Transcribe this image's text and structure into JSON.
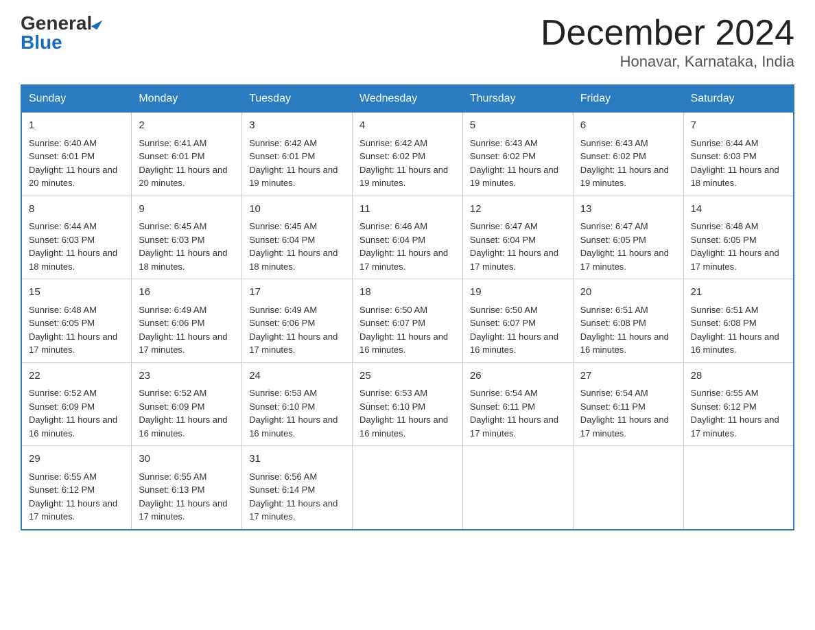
{
  "header": {
    "logo_general": "General",
    "logo_blue": "Blue",
    "month_title": "December 2024",
    "location": "Honavar, Karnataka, India"
  },
  "weekdays": [
    "Sunday",
    "Monday",
    "Tuesday",
    "Wednesday",
    "Thursday",
    "Friday",
    "Saturday"
  ],
  "weeks": [
    [
      {
        "day": "1",
        "sunrise": "6:40 AM",
        "sunset": "6:01 PM",
        "daylight": "11 hours and 20 minutes."
      },
      {
        "day": "2",
        "sunrise": "6:41 AM",
        "sunset": "6:01 PM",
        "daylight": "11 hours and 20 minutes."
      },
      {
        "day": "3",
        "sunrise": "6:42 AM",
        "sunset": "6:01 PM",
        "daylight": "11 hours and 19 minutes."
      },
      {
        "day": "4",
        "sunrise": "6:42 AM",
        "sunset": "6:02 PM",
        "daylight": "11 hours and 19 minutes."
      },
      {
        "day": "5",
        "sunrise": "6:43 AM",
        "sunset": "6:02 PM",
        "daylight": "11 hours and 19 minutes."
      },
      {
        "day": "6",
        "sunrise": "6:43 AM",
        "sunset": "6:02 PM",
        "daylight": "11 hours and 19 minutes."
      },
      {
        "day": "7",
        "sunrise": "6:44 AM",
        "sunset": "6:03 PM",
        "daylight": "11 hours and 18 minutes."
      }
    ],
    [
      {
        "day": "8",
        "sunrise": "6:44 AM",
        "sunset": "6:03 PM",
        "daylight": "11 hours and 18 minutes."
      },
      {
        "day": "9",
        "sunrise": "6:45 AM",
        "sunset": "6:03 PM",
        "daylight": "11 hours and 18 minutes."
      },
      {
        "day": "10",
        "sunrise": "6:45 AM",
        "sunset": "6:04 PM",
        "daylight": "11 hours and 18 minutes."
      },
      {
        "day": "11",
        "sunrise": "6:46 AM",
        "sunset": "6:04 PM",
        "daylight": "11 hours and 17 minutes."
      },
      {
        "day": "12",
        "sunrise": "6:47 AM",
        "sunset": "6:04 PM",
        "daylight": "11 hours and 17 minutes."
      },
      {
        "day": "13",
        "sunrise": "6:47 AM",
        "sunset": "6:05 PM",
        "daylight": "11 hours and 17 minutes."
      },
      {
        "day": "14",
        "sunrise": "6:48 AM",
        "sunset": "6:05 PM",
        "daylight": "11 hours and 17 minutes."
      }
    ],
    [
      {
        "day": "15",
        "sunrise": "6:48 AM",
        "sunset": "6:05 PM",
        "daylight": "11 hours and 17 minutes."
      },
      {
        "day": "16",
        "sunrise": "6:49 AM",
        "sunset": "6:06 PM",
        "daylight": "11 hours and 17 minutes."
      },
      {
        "day": "17",
        "sunrise": "6:49 AM",
        "sunset": "6:06 PM",
        "daylight": "11 hours and 17 minutes."
      },
      {
        "day": "18",
        "sunrise": "6:50 AM",
        "sunset": "6:07 PM",
        "daylight": "11 hours and 16 minutes."
      },
      {
        "day": "19",
        "sunrise": "6:50 AM",
        "sunset": "6:07 PM",
        "daylight": "11 hours and 16 minutes."
      },
      {
        "day": "20",
        "sunrise": "6:51 AM",
        "sunset": "6:08 PM",
        "daylight": "11 hours and 16 minutes."
      },
      {
        "day": "21",
        "sunrise": "6:51 AM",
        "sunset": "6:08 PM",
        "daylight": "11 hours and 16 minutes."
      }
    ],
    [
      {
        "day": "22",
        "sunrise": "6:52 AM",
        "sunset": "6:09 PM",
        "daylight": "11 hours and 16 minutes."
      },
      {
        "day": "23",
        "sunrise": "6:52 AM",
        "sunset": "6:09 PM",
        "daylight": "11 hours and 16 minutes."
      },
      {
        "day": "24",
        "sunrise": "6:53 AM",
        "sunset": "6:10 PM",
        "daylight": "11 hours and 16 minutes."
      },
      {
        "day": "25",
        "sunrise": "6:53 AM",
        "sunset": "6:10 PM",
        "daylight": "11 hours and 16 minutes."
      },
      {
        "day": "26",
        "sunrise": "6:54 AM",
        "sunset": "6:11 PM",
        "daylight": "11 hours and 17 minutes."
      },
      {
        "day": "27",
        "sunrise": "6:54 AM",
        "sunset": "6:11 PM",
        "daylight": "11 hours and 17 minutes."
      },
      {
        "day": "28",
        "sunrise": "6:55 AM",
        "sunset": "6:12 PM",
        "daylight": "11 hours and 17 minutes."
      }
    ],
    [
      {
        "day": "29",
        "sunrise": "6:55 AM",
        "sunset": "6:12 PM",
        "daylight": "11 hours and 17 minutes."
      },
      {
        "day": "30",
        "sunrise": "6:55 AM",
        "sunset": "6:13 PM",
        "daylight": "11 hours and 17 minutes."
      },
      {
        "day": "31",
        "sunrise": "6:56 AM",
        "sunset": "6:14 PM",
        "daylight": "11 hours and 17 minutes."
      },
      null,
      null,
      null,
      null
    ]
  ]
}
